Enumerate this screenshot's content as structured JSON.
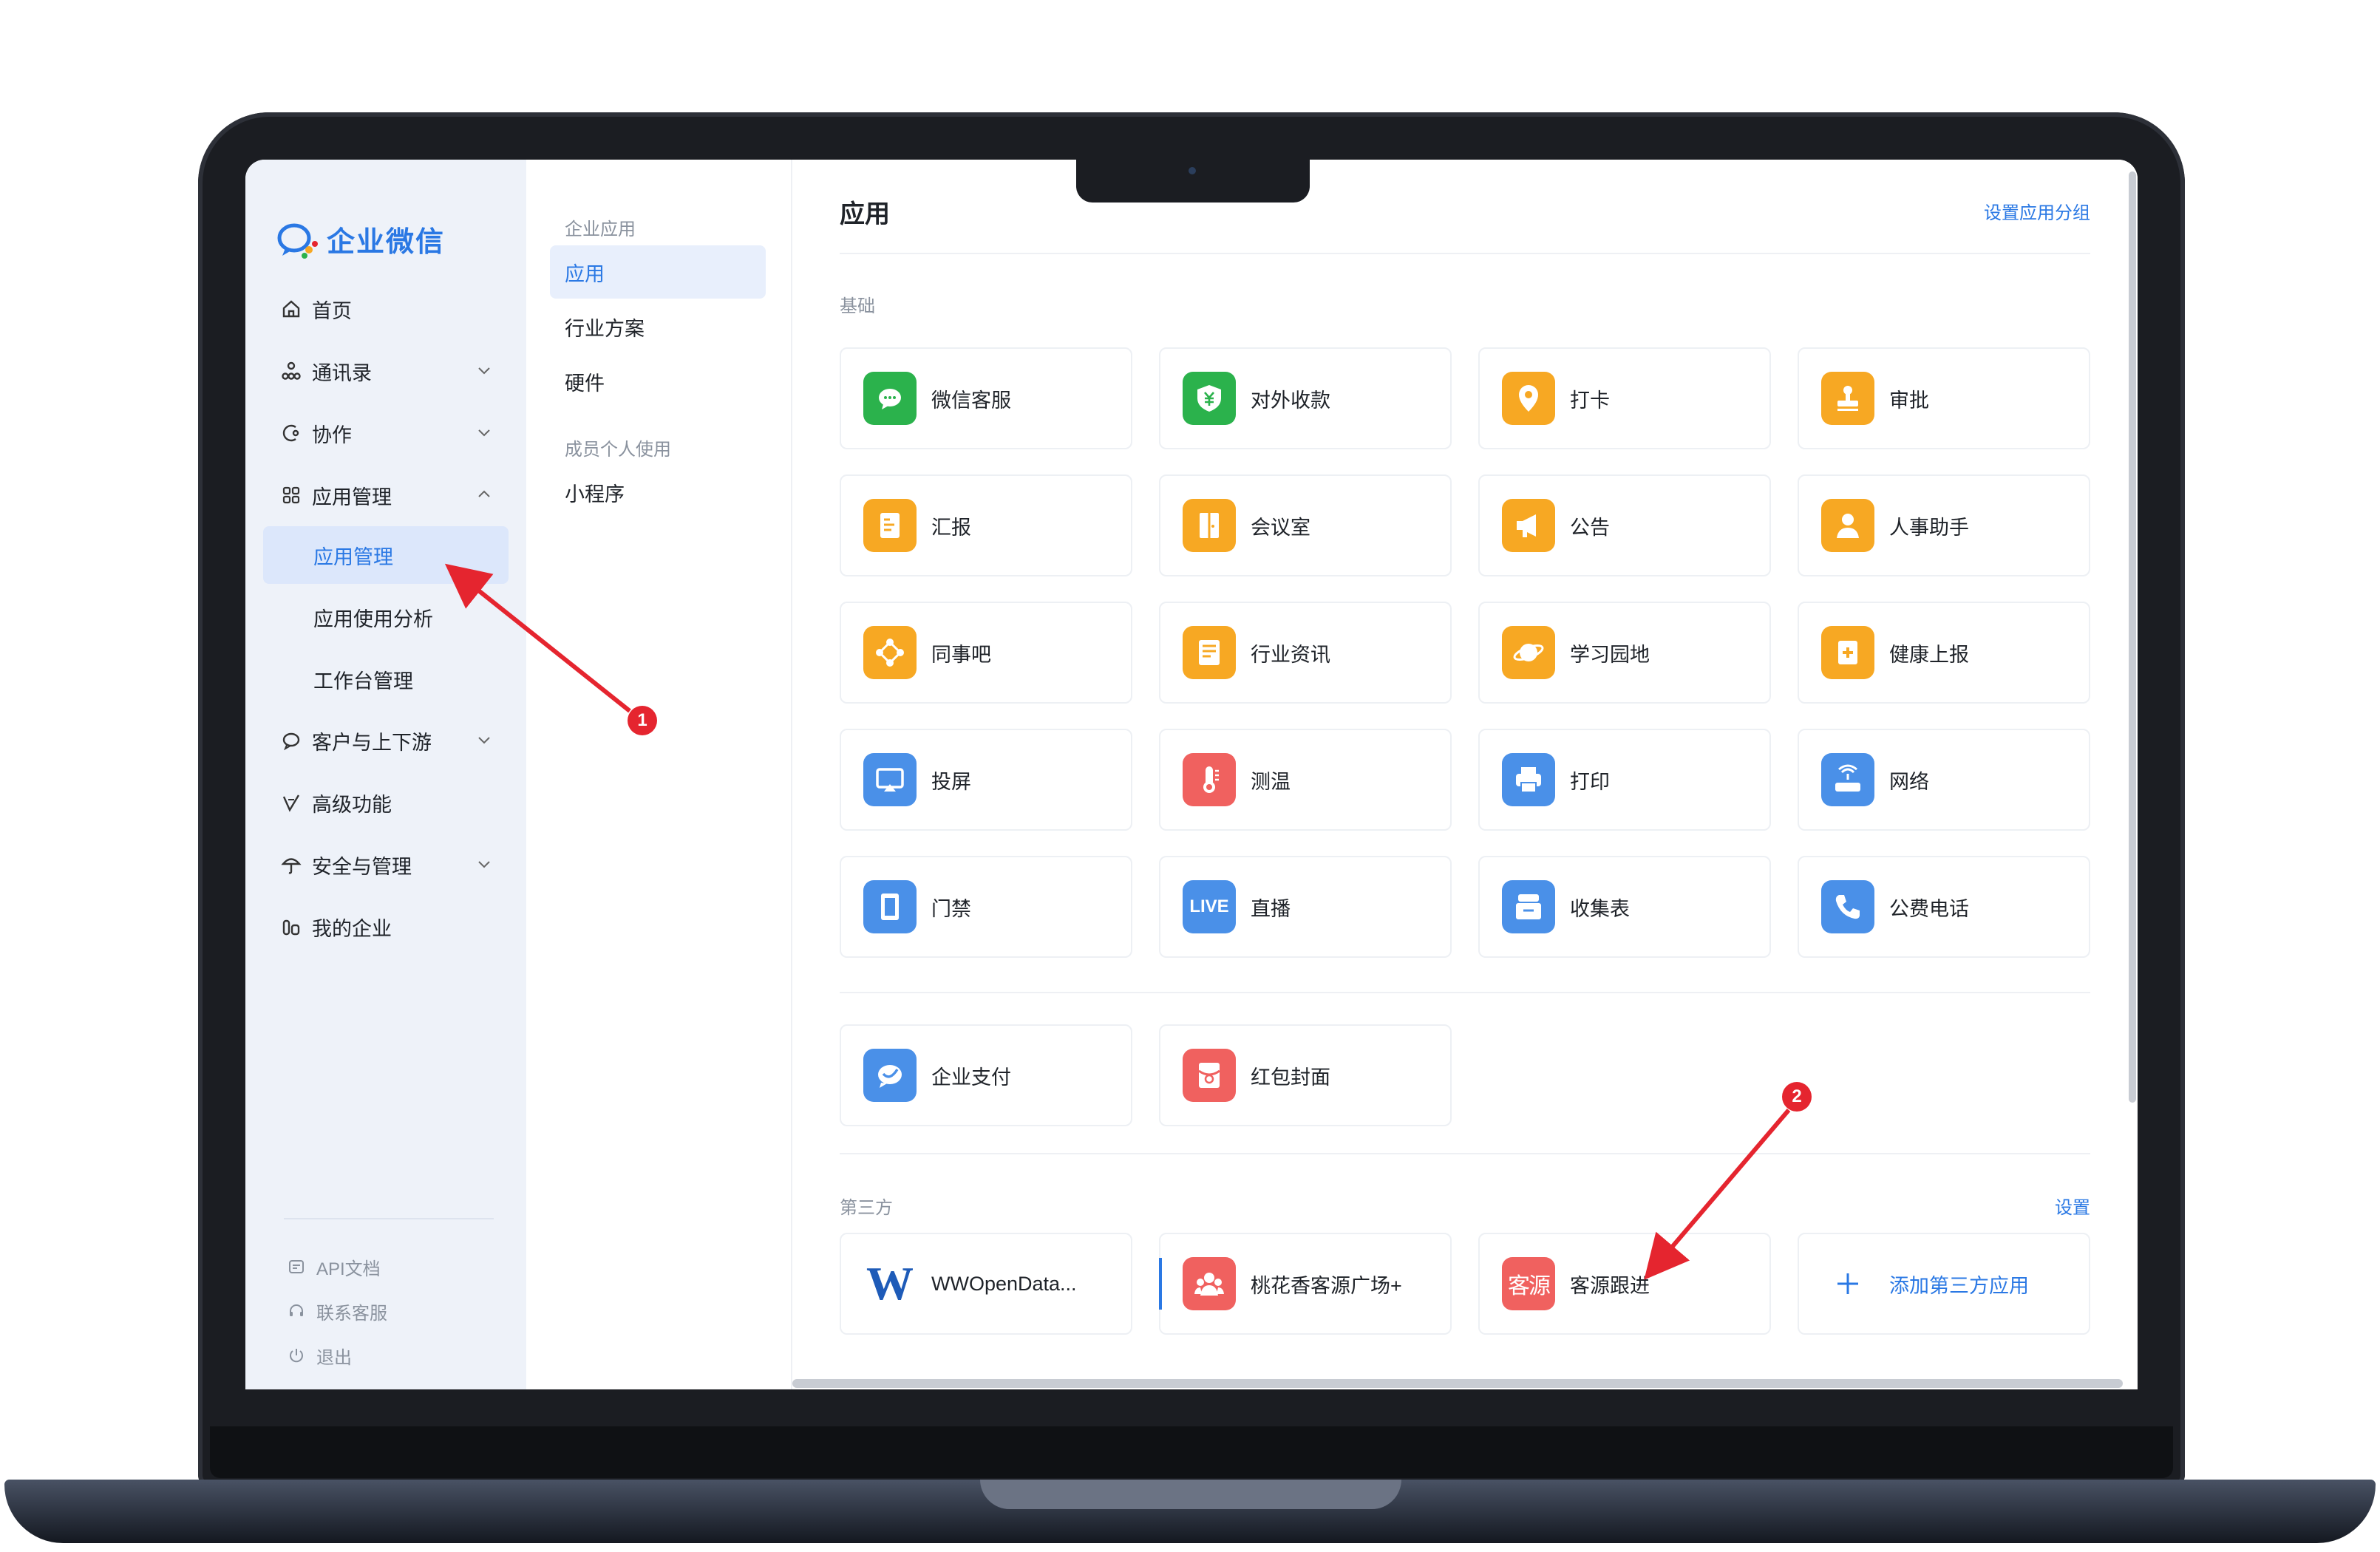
{
  "brand": {
    "name": "企业微信",
    "logo_icon": "wecom-logo-icon",
    "color": "#2a78e4"
  },
  "nav": {
    "items": [
      {
        "label": "首页",
        "icon": "home-icon"
      },
      {
        "label": "通讯录",
        "icon": "org-icon",
        "expandable": true
      },
      {
        "label": "协作",
        "icon": "collab-icon",
        "expandable": true
      },
      {
        "label": "应用管理",
        "icon": "grid-icon",
        "expanded": true
      },
      {
        "label": "客户与上下游",
        "icon": "chat-icon",
        "expandable": true
      },
      {
        "label": "高级功能",
        "icon": "advanced-icon"
      },
      {
        "label": "安全与管理",
        "icon": "umbrella-icon",
        "expandable": true
      },
      {
        "label": "我的企业",
        "icon": "company-icon"
      }
    ],
    "sub_items": [
      {
        "label": "应用管理",
        "active": true
      },
      {
        "label": "应用使用分析"
      },
      {
        "label": "工作台管理"
      }
    ],
    "footer": [
      {
        "label": "API文档",
        "icon": "doc-icon"
      },
      {
        "label": "联系客服",
        "icon": "headset-icon"
      },
      {
        "label": "退出",
        "icon": "power-icon"
      }
    ]
  },
  "menu2": {
    "group1": "企业应用",
    "items1": [
      {
        "label": "应用",
        "active": true
      },
      {
        "label": "行业方案"
      },
      {
        "label": "硬件"
      }
    ],
    "group2": "成员个人使用",
    "items2": [
      {
        "label": "小程序"
      }
    ]
  },
  "main": {
    "title": "应用",
    "action": "设置应用分组",
    "basic_label": "基础",
    "basic_apps": [
      {
        "name": "微信客服",
        "color": "#2bb24c",
        "icon": "wechat-service-icon"
      },
      {
        "name": "对外收款",
        "color": "#2bb24c",
        "icon": "payment-icon"
      },
      {
        "name": "打卡",
        "color": "#f7a823",
        "icon": "location-pin-icon"
      },
      {
        "name": "审批",
        "color": "#f7a823",
        "icon": "stamp-icon"
      },
      {
        "name": "汇报",
        "color": "#f7a823",
        "icon": "report-icon"
      },
      {
        "name": "会议室",
        "color": "#f7a823",
        "icon": "door-icon"
      },
      {
        "name": "公告",
        "color": "#f7a823",
        "icon": "megaphone-icon"
      },
      {
        "name": "人事助手",
        "color": "#f7a823",
        "icon": "person-icon"
      },
      {
        "name": "同事吧",
        "color": "#f7a823",
        "icon": "diamond-nodes-icon"
      },
      {
        "name": "行业资讯",
        "color": "#f7a823",
        "icon": "news-icon"
      },
      {
        "name": "学习园地",
        "color": "#f7a823",
        "icon": "planet-icon"
      },
      {
        "name": "健康上报",
        "color": "#f7a823",
        "icon": "health-icon"
      },
      {
        "name": "投屏",
        "color": "#4a90e8",
        "icon": "screen-cast-icon"
      },
      {
        "name": "测温",
        "color": "#f0615f",
        "icon": "thermometer-icon"
      },
      {
        "name": "打印",
        "color": "#4a90e8",
        "icon": "printer-icon"
      },
      {
        "name": "网络",
        "color": "#4a90e8",
        "icon": "router-icon"
      },
      {
        "name": "门禁",
        "color": "#4a90e8",
        "icon": "gate-icon"
      },
      {
        "name": "直播",
        "color": "#4a90e8",
        "icon": "live-icon",
        "icon_text": "LIVE"
      },
      {
        "name": "收集表",
        "color": "#4a90e8",
        "icon": "collect-form-icon"
      },
      {
        "name": "公费电话",
        "color": "#4a90e8",
        "icon": "phone-icon"
      }
    ],
    "extra_apps": [
      {
        "name": "企业支付",
        "color": "#4a90e8",
        "icon": "enterprise-pay-icon"
      },
      {
        "name": "红包封面",
        "color": "#f0615f",
        "icon": "red-envelope-icon"
      }
    ],
    "third_label": "第三方",
    "third_action": "设置",
    "third_apps": [
      {
        "name": "WWOpenData...",
        "color": "#ffffff",
        "icon": "w-letter-icon",
        "icon_text": "W"
      },
      {
        "name": "桃花香客源广场+",
        "color": "#f0615f",
        "icon": "group-icon"
      },
      {
        "name": "客源跟进",
        "color": "#f0615f",
        "icon": "kehu-icon",
        "icon_text": "客源"
      },
      {
        "name": "添加第三方应用",
        "color": "#ffffff",
        "icon": "plus-icon",
        "add": true
      }
    ]
  },
  "annotations": [
    {
      "label": "1"
    },
    {
      "label": "2"
    }
  ]
}
